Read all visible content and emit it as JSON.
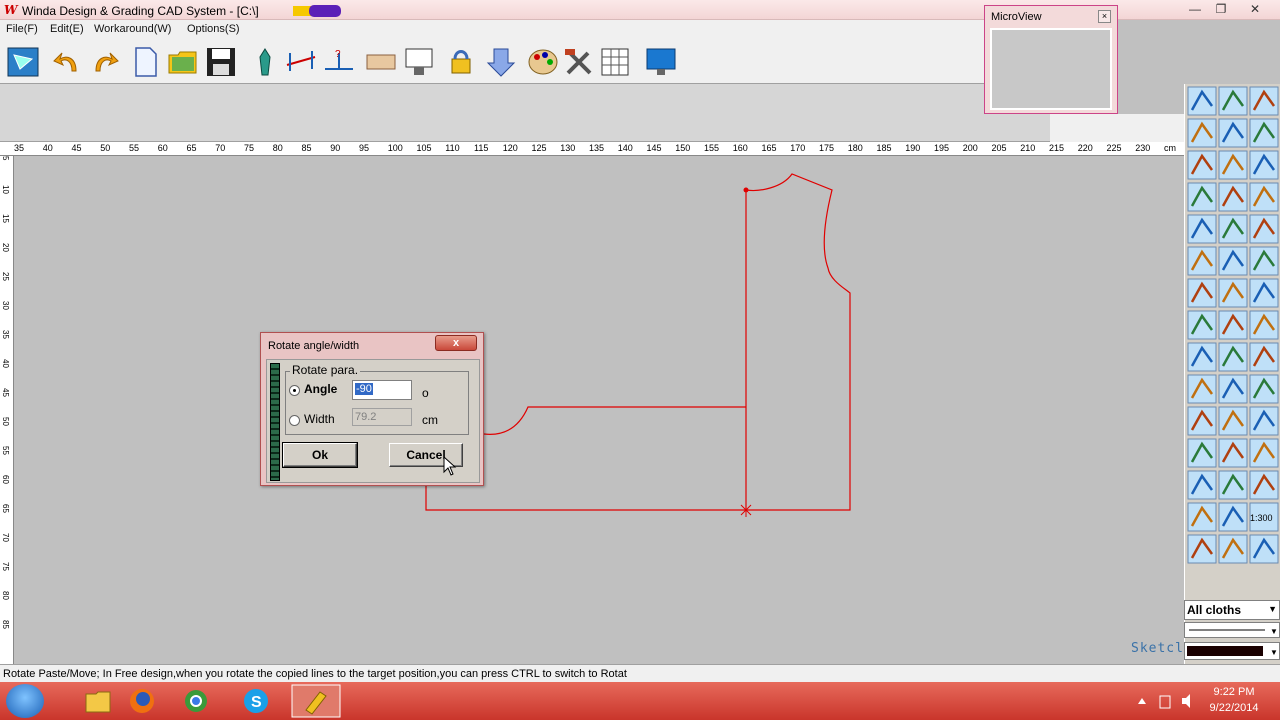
{
  "window": {
    "title": "Winda Design & Grading CAD System - [C:\\]",
    "logo": "W"
  },
  "menu": [
    "File(F)",
    "Edit(E)",
    "Workaround(W)",
    "Options(S)"
  ],
  "microview": {
    "title": "MicroView"
  },
  "ruler": {
    "h_labels": [
      "35",
      "40",
      "45",
      "50",
      "55",
      "60",
      "65",
      "70",
      "75",
      "80",
      "85",
      "90",
      "95",
      "100",
      "105",
      "110",
      "115",
      "120",
      "125",
      "130",
      "135",
      "140",
      "145",
      "150",
      "155",
      "160",
      "165",
      "170",
      "175",
      "180",
      "185",
      "190",
      "195",
      "200",
      "205",
      "210",
      "215",
      "220",
      "225",
      "230",
      "cm"
    ],
    "v_labels": [
      "5",
      "10",
      "15",
      "20",
      "25",
      "30",
      "35",
      "40",
      "45",
      "50",
      "55",
      "60",
      "65",
      "70",
      "75",
      "80",
      "85"
    ]
  },
  "dialog": {
    "title": "Rotate angle/width",
    "close": "x",
    "group_label": "Rotate para.",
    "angle_label": "Angle",
    "angle_value": "-90",
    "angle_unit": "o",
    "width_label": "Width",
    "width_value": "79.2",
    "width_unit": "cm",
    "ok": "Ok",
    "cancel": "Cancel",
    "selected_option": "angle"
  },
  "right_panel": {
    "cloth_select": "All cloths",
    "scale_label": "1:300"
  },
  "sketch_label": "Sketcl",
  "status": "Rotate Paste/Move; In Free design,when you rotate the copied lines to the target position,you can press CTRL to switch to Rotat",
  "clock": {
    "time": "9:22 PM",
    "date": "9/22/2014"
  },
  "colors": {
    "titlebar": "#f3d5d5",
    "canvas": "#c0c0c0",
    "pattern_line": "#e00000",
    "taskbar": "#d04437"
  }
}
